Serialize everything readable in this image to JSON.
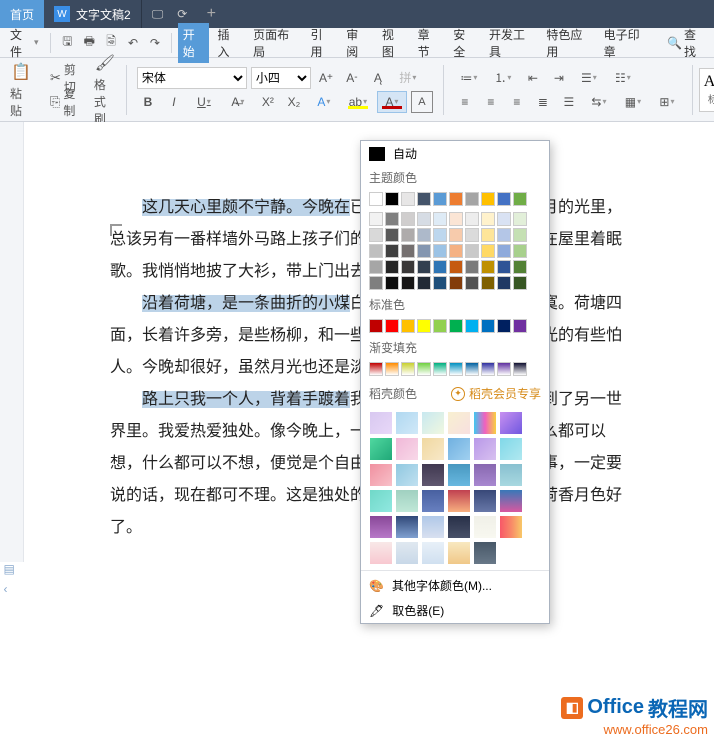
{
  "tabs": {
    "home": "首页",
    "doc": "文字文稿2"
  },
  "menu": {
    "file": "文件",
    "start": "开始",
    "insert": "插入",
    "layout": "页面布局",
    "ref": "引用",
    "review": "审阅",
    "view": "视图",
    "section": "章节",
    "safe": "安全",
    "dev": "开发工具",
    "special": "特色应用",
    "stamp": "电子印章",
    "find": "查找"
  },
  "clip": {
    "cut": "剪切",
    "copy": "复制",
    "paste": "粘贴",
    "painter": "格式刷"
  },
  "font": {
    "family": "宋体",
    "size": "小四"
  },
  "style": {
    "normal_aa": "AaE",
    "normal_label": "标题"
  },
  "popup": {
    "auto": "自动",
    "theme": "主题颜色",
    "standard": "标准色",
    "gradient": "渐变填充",
    "dao_colors": "稻壳颜色",
    "member": "稻壳会员专享",
    "more": "其他字体颜色(M)...",
    "picker": "取色器(E)"
  },
  "colors": {
    "theme_row1": [
      "#ffffff",
      "#000000",
      "#e7e6e6",
      "#44546a",
      "#5b9bd5",
      "#ed7d31",
      "#a5a5a5",
      "#ffc000",
      "#4472c4",
      "#70ad47"
    ],
    "theme_shades": [
      [
        "#f2f2f2",
        "#808080",
        "#d0cece",
        "#d6dce4",
        "#deebf6",
        "#fbe5d5",
        "#ededed",
        "#fff2cc",
        "#d9e2f3",
        "#e2efd9"
      ],
      [
        "#d9d9d9",
        "#595959",
        "#aeabab",
        "#adb9ca",
        "#bdd7ee",
        "#f7cbac",
        "#dbdbdb",
        "#fee599",
        "#b4c6e7",
        "#c5e0b3"
      ],
      [
        "#bfbfbf",
        "#404040",
        "#757070",
        "#8496b0",
        "#9cc3e5",
        "#f4b183",
        "#c9c9c9",
        "#ffd965",
        "#8eaadb",
        "#a8d08d"
      ],
      [
        "#a6a6a6",
        "#262626",
        "#3a3838",
        "#323f4f",
        "#2e75b5",
        "#c55a11",
        "#7b7b7b",
        "#bf9000",
        "#2f5496",
        "#538135"
      ],
      [
        "#7f7f7f",
        "#0d0d0d",
        "#171616",
        "#222a35",
        "#1e4e79",
        "#833c0b",
        "#525252",
        "#7f6000",
        "#1f3864",
        "#375623"
      ]
    ],
    "standard": [
      "#c00000",
      "#ff0000",
      "#ffc000",
      "#ffff00",
      "#92d050",
      "#00b050",
      "#00b0f0",
      "#0070c0",
      "#002060",
      "#7030a0"
    ],
    "gradient": [
      "#c00000",
      "#ff8c00",
      "#c8d030",
      "#70d040",
      "#00b080",
      "#0090c0",
      "#0060a0",
      "#3030a0",
      "#6030a0",
      "#101030"
    ]
  },
  "dao_gradients": [
    [
      "linear-gradient(135deg,#d8c8f0,#e8d8f8)",
      "linear-gradient(135deg,#b0d8f0,#d0e8f8)",
      "linear-gradient(135deg,#c8e8f0,#f0f8e0)",
      "linear-gradient(135deg,#f8f0d0,#f8e0e0)",
      "linear-gradient(90deg,#40c8f0,#f060c0,#f8d040)",
      "linear-gradient(135deg,#c890f0,#7058e0)",
      "linear-gradient(135deg,#50d8a0,#20a878)"
    ],
    [
      "linear-gradient(135deg,#f0b8d8,#f8d8e8)",
      "linear-gradient(135deg,#f0d8a0,#f8e8c8)",
      "linear-gradient(135deg,#70b0e0,#a0d0f0)",
      "linear-gradient(135deg,#b898e8,#d8c0f0)",
      "linear-gradient(135deg,#80d8e8,#b0e8f0)",
      "linear-gradient(135deg,#f090a0,#f8c0c8)",
      "linear-gradient(135deg,#90c8e0,#c0e0f0)"
    ],
    [
      "linear-gradient(#403850,#605870)",
      "linear-gradient(#4898c0,#68b8e0)",
      "linear-gradient(#8868b0,#a888d0)",
      "linear-gradient(#88c0d0,#a8d8e0)",
      "linear-gradient(135deg,#70d8c8,#90e8e0)",
      "linear-gradient(#a0d0c0,#c0e8d8)",
      "linear-gradient(#4860a0,#6880c0)"
    ],
    [
      "linear-gradient(#c04050,#f8b080)",
      "linear-gradient(#384878,#6878a8)",
      "linear-gradient(#3878b8,#d858a0)",
      "linear-gradient(#884898,#b878c8)",
      "linear-gradient(#304878,#80a0d0)",
      "linear-gradient(#b0c8e8,#d8e0f0)",
      "linear-gradient(#283048,#485068)"
    ],
    [
      "linear-gradient(#f0f0e8,#f8f8f0)",
      "linear-gradient(90deg,#f85868,#f88868,#f8c868)",
      "linear-gradient(#f8e8e8,#f8c8d0)",
      "linear-gradient(#e0e8f0,#c8d8e8)",
      "linear-gradient(#e8f0f8,#d0e0f0)",
      "linear-gradient(#f8e8c0,#f0c888)",
      "linear-gradient(#485868,#687888)"
    ]
  ],
  "doc": {
    "p1a": "这几天心里颇不宁静。今晚在",
    "p1b": "已日日走过的荷塘，在这满月的光里，总该另有一番样",
    "p1c": "墙外马路上孩子们的欢笑，已经听不见了；妻在屋里",
    "p1d": "着眠歌。我悄悄地披了大衫，带上门出去。",
    "p2a": "沿着荷塘，是一条曲折的小煤",
    "p2b": "白天也少人走，夜晚更加寂寞。荷塘四面，长着许多",
    "p2c": "旁，是些杨柳，和一些不知道名字的树。没有月光的",
    "p2d": "有些怕人。今晚却很好，虽然月光也还是淡淡的。",
    "p3a": "路上只我一个人，背着手踱着",
    "p3b": "我也像超出了平常的自己，到了另一世界里。我爱热",
    "p3c": "爱独处。像今晚上，一个人在这苍茫的月下，什么都可以想，什么都可以不想，便觉是个自由的人。白天里一定要做的事，一定要说的话，现在都可不理。这是独处的妙处，我且受用这无边的荷香月色好了。"
  },
  "watermark": {
    "line1a": "Office",
    "line1b": "教程网",
    "line2": "www.office26.com"
  }
}
